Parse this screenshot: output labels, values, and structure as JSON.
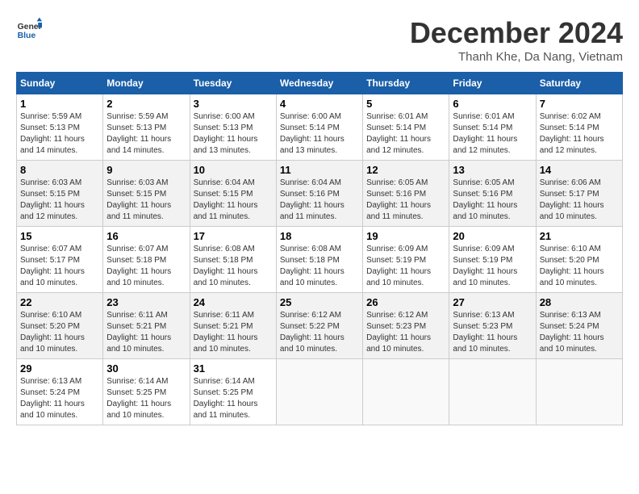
{
  "header": {
    "logo_general": "General",
    "logo_blue": "Blue",
    "month_title": "December 2024",
    "location": "Thanh Khe, Da Nang, Vietnam"
  },
  "calendar": {
    "days_of_week": [
      "Sunday",
      "Monday",
      "Tuesday",
      "Wednesday",
      "Thursday",
      "Friday",
      "Saturday"
    ],
    "weeks": [
      [
        {
          "day": "",
          "info": ""
        },
        {
          "day": "2",
          "info": "Sunrise: 5:59 AM\nSunset: 5:13 PM\nDaylight: 11 hours\nand 14 minutes."
        },
        {
          "day": "3",
          "info": "Sunrise: 6:00 AM\nSunset: 5:13 PM\nDaylight: 11 hours\nand 13 minutes."
        },
        {
          "day": "4",
          "info": "Sunrise: 6:00 AM\nSunset: 5:14 PM\nDaylight: 11 hours\nand 13 minutes."
        },
        {
          "day": "5",
          "info": "Sunrise: 6:01 AM\nSunset: 5:14 PM\nDaylight: 11 hours\nand 12 minutes."
        },
        {
          "day": "6",
          "info": "Sunrise: 6:01 AM\nSunset: 5:14 PM\nDaylight: 11 hours\nand 12 minutes."
        },
        {
          "day": "7",
          "info": "Sunrise: 6:02 AM\nSunset: 5:14 PM\nDaylight: 11 hours\nand 12 minutes."
        }
      ],
      [
        {
          "day": "8",
          "info": "Sunrise: 6:03 AM\nSunset: 5:15 PM\nDaylight: 11 hours\nand 12 minutes."
        },
        {
          "day": "9",
          "info": "Sunrise: 6:03 AM\nSunset: 5:15 PM\nDaylight: 11 hours\nand 11 minutes."
        },
        {
          "day": "10",
          "info": "Sunrise: 6:04 AM\nSunset: 5:15 PM\nDaylight: 11 hours\nand 11 minutes."
        },
        {
          "day": "11",
          "info": "Sunrise: 6:04 AM\nSunset: 5:16 PM\nDaylight: 11 hours\nand 11 minutes."
        },
        {
          "day": "12",
          "info": "Sunrise: 6:05 AM\nSunset: 5:16 PM\nDaylight: 11 hours\nand 11 minutes."
        },
        {
          "day": "13",
          "info": "Sunrise: 6:05 AM\nSunset: 5:16 PM\nDaylight: 11 hours\nand 10 minutes."
        },
        {
          "day": "14",
          "info": "Sunrise: 6:06 AM\nSunset: 5:17 PM\nDaylight: 11 hours\nand 10 minutes."
        }
      ],
      [
        {
          "day": "15",
          "info": "Sunrise: 6:07 AM\nSunset: 5:17 PM\nDaylight: 11 hours\nand 10 minutes."
        },
        {
          "day": "16",
          "info": "Sunrise: 6:07 AM\nSunset: 5:18 PM\nDaylight: 11 hours\nand 10 minutes."
        },
        {
          "day": "17",
          "info": "Sunrise: 6:08 AM\nSunset: 5:18 PM\nDaylight: 11 hours\nand 10 minutes."
        },
        {
          "day": "18",
          "info": "Sunrise: 6:08 AM\nSunset: 5:18 PM\nDaylight: 11 hours\nand 10 minutes."
        },
        {
          "day": "19",
          "info": "Sunrise: 6:09 AM\nSunset: 5:19 PM\nDaylight: 11 hours\nand 10 minutes."
        },
        {
          "day": "20",
          "info": "Sunrise: 6:09 AM\nSunset: 5:19 PM\nDaylight: 11 hours\nand 10 minutes."
        },
        {
          "day": "21",
          "info": "Sunrise: 6:10 AM\nSunset: 5:20 PM\nDaylight: 11 hours\nand 10 minutes."
        }
      ],
      [
        {
          "day": "22",
          "info": "Sunrise: 6:10 AM\nSunset: 5:20 PM\nDaylight: 11 hours\nand 10 minutes."
        },
        {
          "day": "23",
          "info": "Sunrise: 6:11 AM\nSunset: 5:21 PM\nDaylight: 11 hours\nand 10 minutes."
        },
        {
          "day": "24",
          "info": "Sunrise: 6:11 AM\nSunset: 5:21 PM\nDaylight: 11 hours\nand 10 minutes."
        },
        {
          "day": "25",
          "info": "Sunrise: 6:12 AM\nSunset: 5:22 PM\nDaylight: 11 hours\nand 10 minutes."
        },
        {
          "day": "26",
          "info": "Sunrise: 6:12 AM\nSunset: 5:23 PM\nDaylight: 11 hours\nand 10 minutes."
        },
        {
          "day": "27",
          "info": "Sunrise: 6:13 AM\nSunset: 5:23 PM\nDaylight: 11 hours\nand 10 minutes."
        },
        {
          "day": "28",
          "info": "Sunrise: 6:13 AM\nSunset: 5:24 PM\nDaylight: 11 hours\nand 10 minutes."
        }
      ],
      [
        {
          "day": "29",
          "info": "Sunrise: 6:13 AM\nSunset: 5:24 PM\nDaylight: 11 hours\nand 10 minutes."
        },
        {
          "day": "30",
          "info": "Sunrise: 6:14 AM\nSunset: 5:25 PM\nDaylight: 11 hours\nand 10 minutes."
        },
        {
          "day": "31",
          "info": "Sunrise: 6:14 AM\nSunset: 5:25 PM\nDaylight: 11 hours\nand 11 minutes."
        },
        {
          "day": "",
          "info": ""
        },
        {
          "day": "",
          "info": ""
        },
        {
          "day": "",
          "info": ""
        },
        {
          "day": "",
          "info": ""
        }
      ]
    ],
    "week0_sunday": {
      "day": "1",
      "info": "Sunrise: 5:59 AM\nSunset: 5:13 PM\nDaylight: 11 hours\nand 14 minutes."
    }
  }
}
